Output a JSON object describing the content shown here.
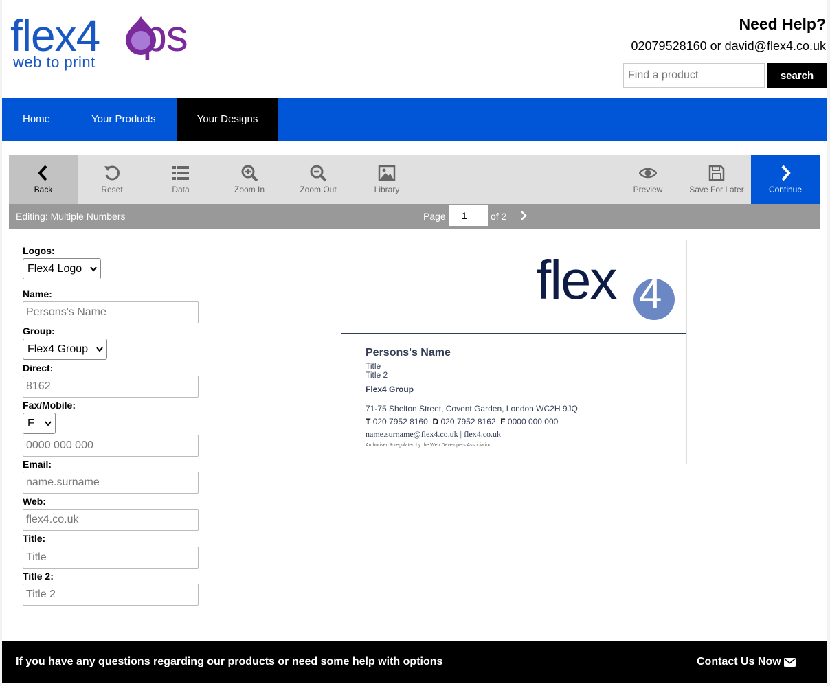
{
  "brand": {
    "logo_main": "flex4",
    "logo_ops": "ps",
    "logo_sub": "web to print"
  },
  "help": {
    "title": "Need Help?",
    "contact": "02079528160 or david@flex4.co.uk"
  },
  "search": {
    "placeholder": "Find a product",
    "button": "search"
  },
  "nav": {
    "items": [
      "Home",
      "Your Products",
      "Your Designs"
    ]
  },
  "toolbar": {
    "back": "Back",
    "reset": "Reset",
    "data": "Data",
    "zoom_in": "Zoom In",
    "zoom_out": "Zoom Out",
    "library": "Library",
    "preview": "Preview",
    "save_for_later": "Save For Later",
    "continue": "Continue"
  },
  "editbar": {
    "editing": "Editing: Multiple Numbers",
    "page_label": "Page",
    "page_value": "1",
    "page_of": "of 2"
  },
  "form": {
    "logos_label": "Logos:",
    "logos_value": "Flex4 Logo",
    "name_label": "Name:",
    "name_placeholder": "Persons's Name",
    "group_label": "Group:",
    "group_value": "Flex4 Group",
    "direct_label": "Direct:",
    "direct_placeholder": "8162",
    "fax_label": "Fax/Mobile:",
    "fax_type": "F",
    "fax_placeholder": "0000 000 000",
    "email_label": "Email:",
    "email_placeholder": "name.surname",
    "web_label": "Web:",
    "web_placeholder": "flex4.co.uk",
    "title_label": "Title:",
    "title_placeholder": "Title",
    "title2_label": "Title 2:",
    "title2_placeholder": "Title 2"
  },
  "card": {
    "logo": "flex",
    "logo_four": "4",
    "name": "Persons's Name",
    "title": "Title",
    "title2": "Title 2",
    "group": "Flex4 Group",
    "address": "71-75 Shelton Street, Covent Garden, London WC2H 9JQ",
    "t_label": "T",
    "t_value": "020 7952 8160",
    "d_label": "D",
    "d_value": "020 7952 8162",
    "f_label": "F",
    "f_value": "0000 000 000",
    "email_web": "name.surname@flex4.co.uk |   flex4.co.uk",
    "footnote": "Authorised & regulated by the Web Developers Association"
  },
  "footer": {
    "text": "If you have any questions regarding our products or need some help with options",
    "contact": "Contact Us Now"
  },
  "colors": {
    "nav_blue": "#0056d6",
    "brand_blue": "#1957c2",
    "brand_purple": "#7a2a9b",
    "card_navy": "#0e1b45"
  }
}
